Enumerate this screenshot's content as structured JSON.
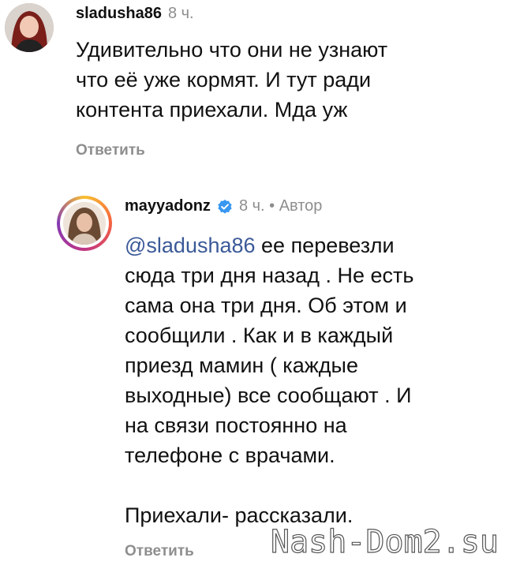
{
  "comments": [
    {
      "username": "sladusha86",
      "time": "8 ч.",
      "text": "Удивительно что они не узнают\nчто её уже кормят. И тут ради\nконтента приехали. Мда уж",
      "reply_label": "Ответить"
    },
    {
      "username": "mayyadonz",
      "time": "8 ч. • Автор",
      "mention": "@sladusha86",
      "text": " ее перевезли\nсюда три дня назад . Не есть\nсама она три дня. Об этом и\nсообщили . Как и в каждый\nприезд мамин ( каждые\nвыходные) все сообщают . И\nна связи постоянно на\nтелефоне с врачами.\n\nПриехали- рассказали.",
      "reply_label": "Ответить",
      "verified_icon": "verified-badge-icon"
    }
  ],
  "watermark": "Nash-Dom2.su"
}
